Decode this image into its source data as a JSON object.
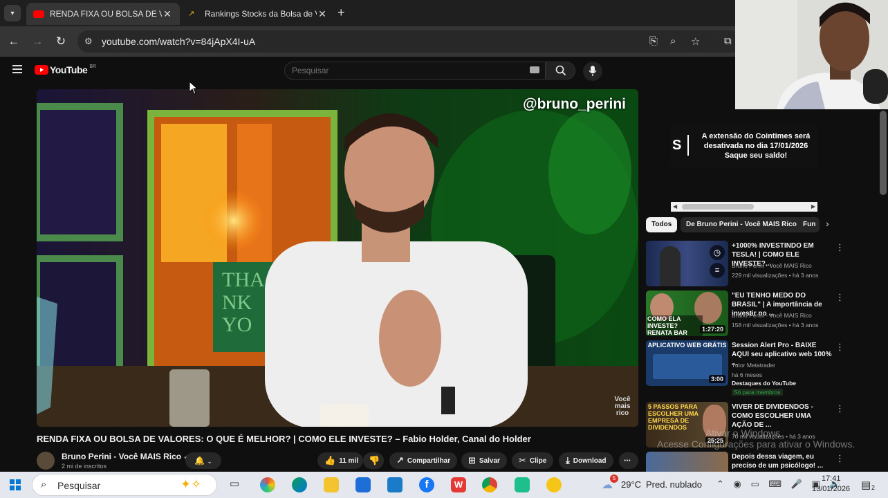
{
  "browser": {
    "tabs": [
      {
        "title": "RENDA FIXA OU BOLSA DE VALORES",
        "favicon": "youtube-icon",
        "active": true
      },
      {
        "title": "Rankings Stocks da Bolsa de Valores",
        "favicon": "chart-icon",
        "active": false
      }
    ],
    "new_tab": "+",
    "url": "youtube.com/watch?v=84jApX4I-uA"
  },
  "youtube": {
    "logo_text": "YouTube",
    "logo_country": "BR",
    "search_placeholder": "Pesquisar",
    "video": {
      "watermark": "@bruno_perini",
      "brand_mark": "Você mais rico",
      "title": "RENDA FIXA OU BOLSA DE VALORES: O QUE É MELHOR? | COMO ELE INVESTE? – Fabio Holder, Canal do Holder"
    },
    "channel": {
      "name": "Bruno Perini - Você MAIS Rico",
      "subscribers": "2 mi de inscritos"
    },
    "actions": {
      "likes": "11 mil",
      "share": "Compartilhar",
      "save": "Salvar",
      "clip": "Clipe",
      "download": "Download",
      "more": "⋯"
    },
    "ad": {
      "logo": "S",
      "line1": "A extensão do Cointimes será",
      "line2": "desativada no dia 17/01/2026",
      "line3": "Saque seu saldo!"
    },
    "chips": [
      "Todos",
      "De Bruno Perini - Você MAIS Rico",
      "Fun"
    ],
    "recommendations": [
      {
        "title": "+1000% INVESTINDO EM TESLA! | COMO ELE INVESTE?...",
        "channel": "Bruno Perini - Você MAIS Rico",
        "meta": "229 mil visualizações • há 3 anos",
        "duration": ""
      },
      {
        "title": "\"EU TENHO MEDO DO BRASIL\" | A importância de investir no ...",
        "channel": "Bruno Perini - Você MAIS Rico",
        "meta": "158 mil visualizações • há 3 anos",
        "duration": "1:27:20",
        "thumb_text": "COMO ELA INVESTE? RENATA BAR"
      },
      {
        "title": "Session Alert Pro - BAIXE AQUI seu aplicativo web 100% ...",
        "channel": "Tutor Metatrader",
        "meta": "há 6 meses",
        "duration": "3:00",
        "thumb_text": "APLICATIVO WEB GRÁTIS",
        "badge1": "Destaques do YouTube",
        "badge2": "Só para membros"
      },
      {
        "title": "VIVER DE DIVIDENDOS - COMO ESCOLHER UMA AÇÃO DE ...",
        "channel": "",
        "meta": "70 mil visualizações • há 3 anos",
        "duration": "25:25",
        "thumb_text": "5 PASSOS PARA ESCOLHER UMA EMPRESA DE DIVIDENDOS"
      },
      {
        "title": "Depois dessa viagem, eu preciso de um psicólogo! ...",
        "channel": "",
        "meta": "",
        "duration": ""
      }
    ]
  },
  "windows": {
    "activate_line1": "Ativar o Windows",
    "activate_line2": "Acesse Configurações para ativar o Windows.",
    "search": "Pesquisar",
    "weather_badge": "5",
    "temperature": "29°C",
    "condition": "Pred. nublado",
    "time": "17:41",
    "date": "13/01/2026",
    "notifications": "2"
  },
  "colors": {
    "yt_red": "#ff0000",
    "bg": "#0f0f0f",
    "taskbar": "#e4e8ee"
  }
}
